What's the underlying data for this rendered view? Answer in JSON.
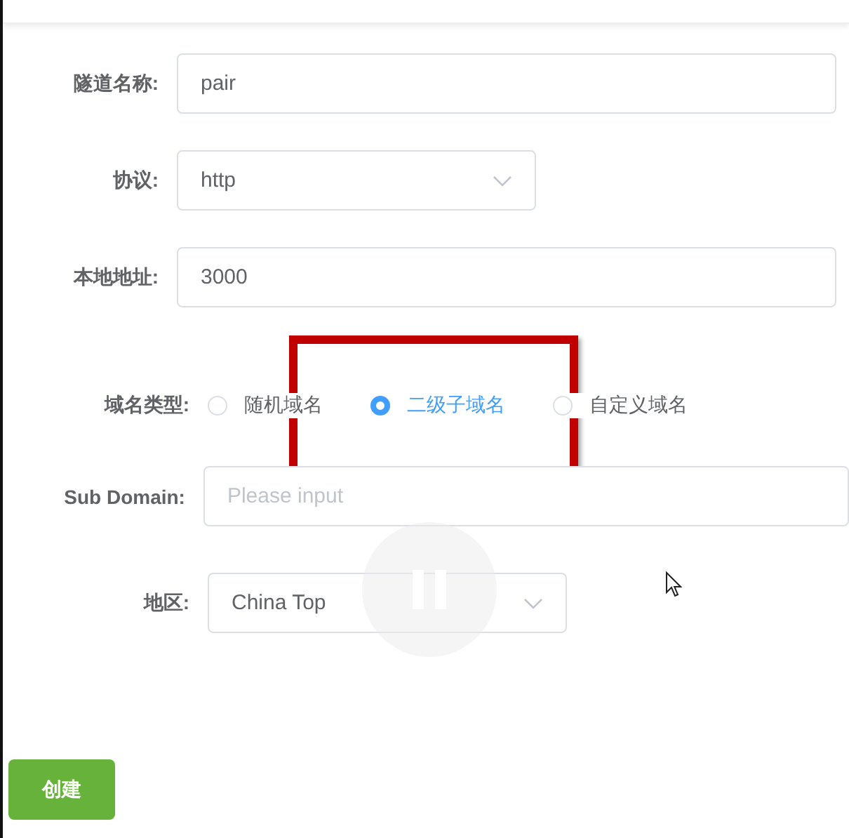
{
  "fields": [
    {
      "label": "隧道名称:",
      "kind": "text",
      "value": "pair"
    },
    {
      "label": "协议:",
      "kind": "select",
      "value": "http"
    },
    {
      "label": "本地地址:",
      "kind": "text",
      "value": "3000"
    }
  ],
  "domain_type": {
    "label": "域名类型:",
    "options": [
      {
        "label": "随机域名",
        "selected": false
      },
      {
        "label": "二级子域名",
        "selected": true
      },
      {
        "label": "自定义域名",
        "selected": false
      }
    ]
  },
  "sub_domain": {
    "label": "Sub Domain:",
    "placeholder": "Please input"
  },
  "region": {
    "label": "地区:",
    "value": "China Top"
  },
  "create_button": "创建"
}
